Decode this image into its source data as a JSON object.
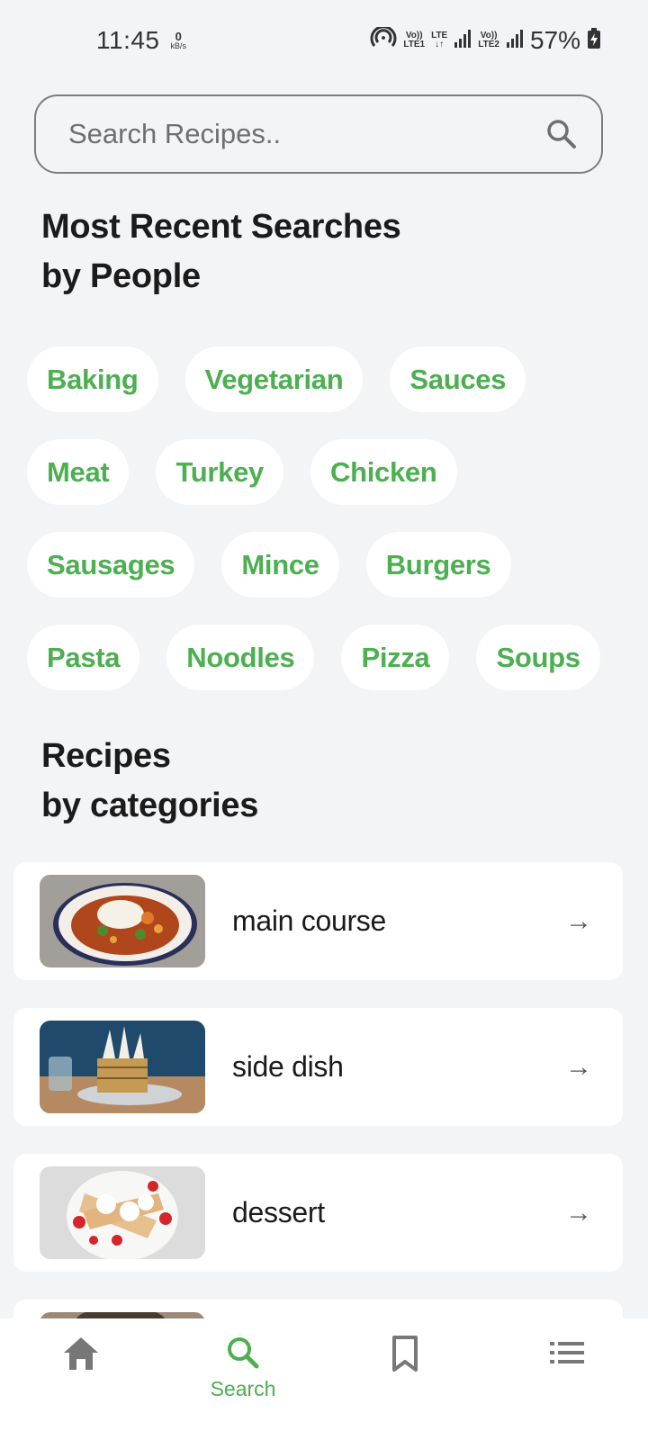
{
  "status_bar": {
    "time": "11:45",
    "net_speed_value": "0",
    "net_speed_unit": "kB/s",
    "sim1_top": "Vo))",
    "sim1_bottom": "LTE1",
    "lte_label": "LTE",
    "sim2_top": "Vo))",
    "sim2_bottom": "LTE2",
    "battery": "57%"
  },
  "search": {
    "placeholder": "Search Recipes.."
  },
  "recent": {
    "title_line1": "Most Recent Searches",
    "title_line2": "by People",
    "chips": [
      "Baking",
      "Vegetarian",
      "Sauces",
      "Meat",
      "Turkey",
      "Chicken",
      "Sausages",
      "Mince",
      "Burgers",
      "Pasta",
      "Noodles",
      "Pizza",
      "Soups"
    ]
  },
  "categories": {
    "title_line1": "Recipes",
    "title_line2": "by categories",
    "items": [
      {
        "label": "main course",
        "arrow": "→"
      },
      {
        "label": "side dish",
        "arrow": "→"
      },
      {
        "label": "dessert",
        "arrow": "→"
      }
    ]
  },
  "bottom_nav": {
    "search_label": "Search",
    "active": "search"
  },
  "colors": {
    "accent": "#4caf50",
    "background": "#f3f4f6",
    "card": "#ffffff"
  }
}
